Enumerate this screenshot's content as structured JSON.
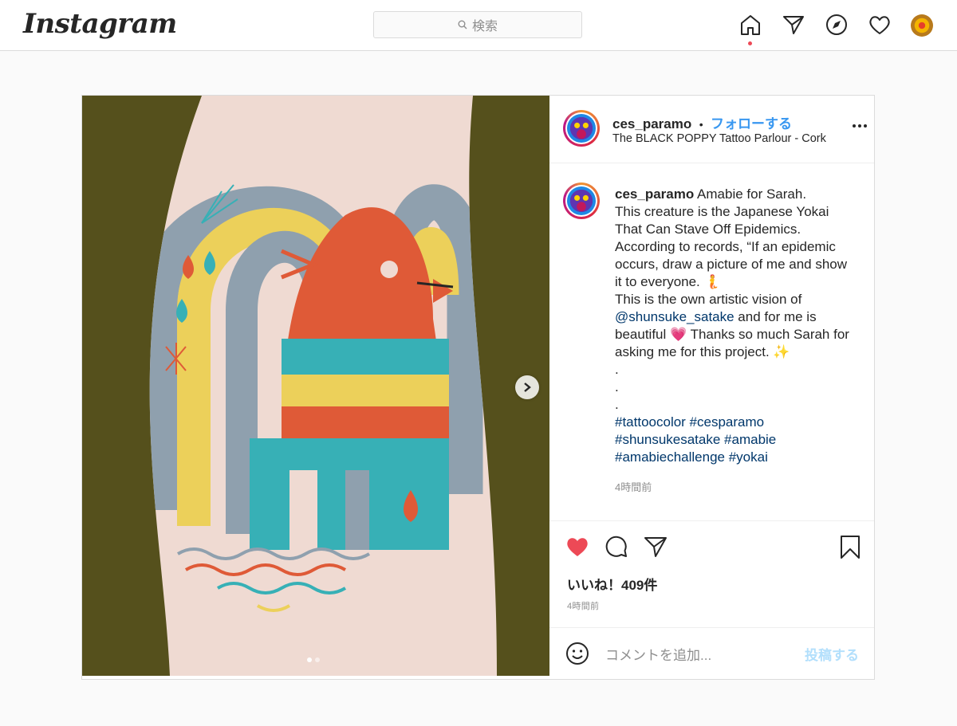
{
  "nav": {
    "logo": "Instagram",
    "search_placeholder": "検索",
    "icons": [
      "home-icon",
      "direct-icon",
      "explore-icon",
      "activity-icon",
      "profile-avatar"
    ]
  },
  "post": {
    "username": "ces_paramo",
    "follow_label": "フォローする",
    "bullet": "•",
    "location": "The BLACK POPPY Tattoo Parlour - Cork",
    "caption": {
      "username": "ces_paramo",
      "text_1": "Amabie for Sarah.",
      "lines": [
        "This creature is the Japanese Yokai",
        "That Can Stave Off Epidemics.",
        "According to records, “If an epidemic",
        "occurs, draw a picture of me and show",
        "it to everyone. 🧜",
        "This is the own artistic vision of"
      ],
      "mention": "@shunsuke_satake",
      "after_mention": " and for me is",
      "line_beautiful": "beautiful 💗 Thanks so much Sarah for",
      "line_asking": "asking me for this project. ✨",
      "dot": ".",
      "hashtag_line_1": "#tattoocolor #cesparamo",
      "hashtag_line_2": "#shunsukesatake #amabie",
      "hashtag_line_3": "#amabiechallenge #yokai",
      "time": "4時間前"
    },
    "likes": "いいね！409件",
    "time": "4時間前",
    "comment_placeholder": "コメントを追加...",
    "post_button": "投稿する",
    "carousel": {
      "current": 1,
      "total": 2
    },
    "colors": {
      "like_red": "#ed4956",
      "link_blue": "#3897f0",
      "hashtag": "#00376b"
    }
  }
}
